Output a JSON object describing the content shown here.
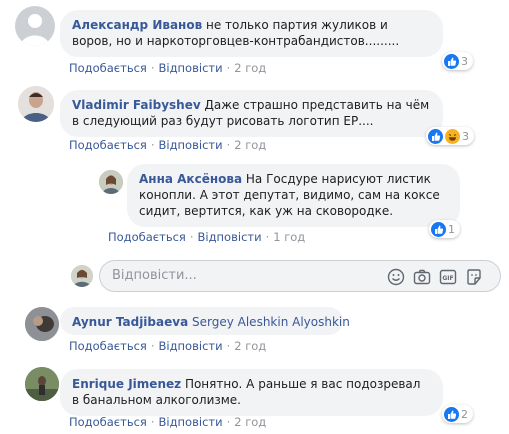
{
  "comments": [
    {
      "author": "Александр Иванов",
      "text": "не только партия жуликов и воров, но и наркоторговцев-контрабандистов.........",
      "like": "Подобається",
      "reply": "Відповісти",
      "time": "2 год",
      "reactions": "3"
    },
    {
      "author": "Vladimir Faibyshev",
      "text": "Даже страшно представить на чём в следующий раз будут рисовать логотип ЕР....",
      "like": "Подобається",
      "reply": "Відповісти",
      "time": "2 год",
      "reactions": "3"
    },
    {
      "author": "Анна Аксёнова",
      "text": "На Госдуре нарисуют листик конопли. А этот депутат, видимо, сам на коксе сидит, вертится, как уж на сковородке.",
      "like": "Подобається",
      "reply": "Відповісти",
      "time": "1 год",
      "reactions": "1"
    },
    {
      "author": "Aynur Tadjibaeva",
      "tag": "Sergey Aleshkin Alyoshkin",
      "like": "Подобається",
      "reply": "Відповісти",
      "time": "2 год"
    },
    {
      "author": "Enrique Jimenez",
      "text": "Понятно. А раньше я вас подозревал в банальном алкоголизме.",
      "like": "Подобається",
      "reply": "Відповісти",
      "time": "2 год",
      "reactions": "2"
    }
  ],
  "reply_box": {
    "placeholder": "Відповісти..."
  },
  "icons": [
    "emoji-icon",
    "camera-icon",
    "gif-icon",
    "sticker-icon",
    "like-reaction-icon",
    "haha-reaction-icon"
  ],
  "colors": {
    "link": "#385898",
    "bubble": "#f2f3f5",
    "meta": "#90949c",
    "like": "#1877f2"
  }
}
